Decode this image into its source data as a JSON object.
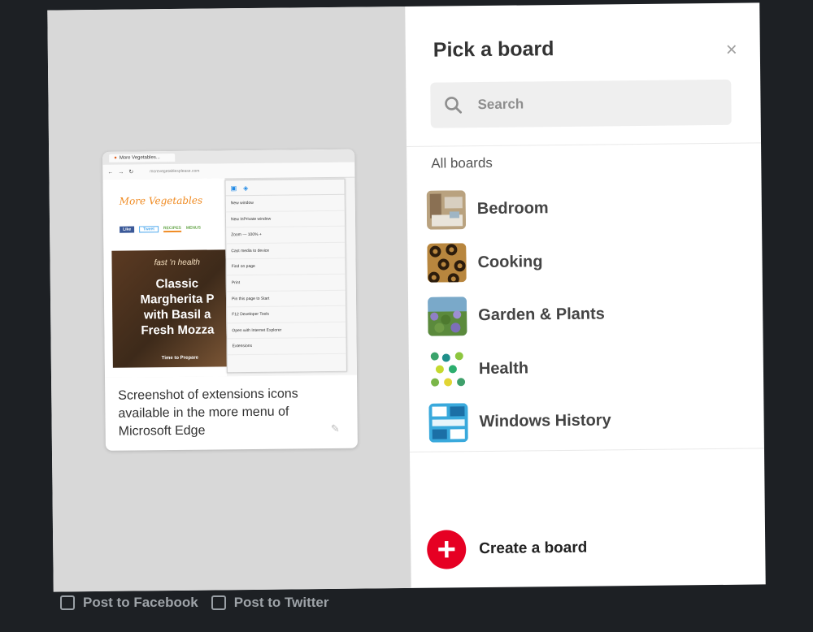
{
  "pin": {
    "description": "Screenshot of extensions icons available in the more menu of Microsoft Edge",
    "screenshot": {
      "tab_title": "More Vegetables...",
      "url": "morevegetablesplease.com",
      "site_logo": "More Vegetables",
      "nav": [
        "Like",
        "Tweet",
        "RECIPES",
        "MENUS"
      ],
      "hero_script": "fast 'n health",
      "hero_title": "Classic\nMargherita P\nwith Basil a\nFresh Mozza",
      "hero_footer": "Time to Prepare",
      "menu_items": [
        "New window",
        "New InPrivate window",
        "Zoom   —  100%  +",
        "Cast media to device",
        "Find on page",
        "Print",
        "Pin this page to Start",
        "F12 Developer Tools",
        "Open with Internet Explorer",
        "Extensions"
      ]
    }
  },
  "panel": {
    "title": "Pick a board",
    "close_icon": "×",
    "search": {
      "placeholder": "Search"
    },
    "section_label": "All boards",
    "boards": [
      {
        "name": "Bedroom"
      },
      {
        "name": "Cooking"
      },
      {
        "name": "Garden & Plants"
      },
      {
        "name": "Health"
      },
      {
        "name": "Windows History"
      }
    ],
    "create_label": "Create a board",
    "create_icon": "+"
  },
  "share": {
    "facebook_label": "Post to Facebook",
    "twitter_label": "Post to Twitter"
  },
  "colors": {
    "accent": "#e60023",
    "left_pane": "#d8d8d8",
    "backdrop": "#1d2024"
  }
}
